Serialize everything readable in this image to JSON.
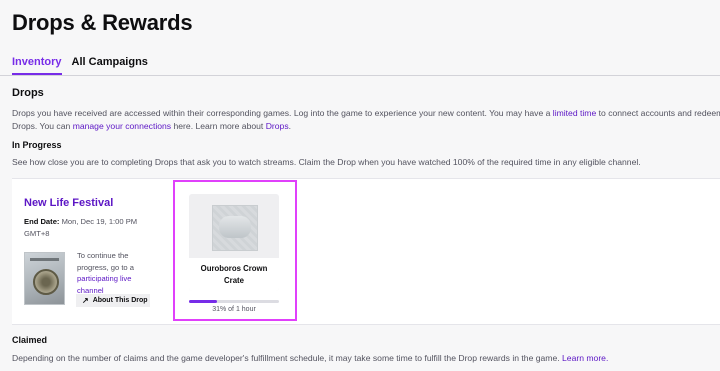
{
  "header": {
    "title": "Drops & Rewards"
  },
  "tabs": [
    {
      "label": "Inventory",
      "active": true
    },
    {
      "label": "All Campaigns",
      "active": false
    }
  ],
  "drops_section": {
    "heading": "Drops",
    "line1_before": "Drops you have received are accessed within their corresponding games. Log into the game to experience your new content. You may have a ",
    "line1_link": "limited time",
    "line1_after": " to connect accounts and redeem your",
    "line2_before": "Drops. You can ",
    "line2_link": "manage your connections",
    "line2_middle": " here. Learn more about ",
    "line2_link2": "Drops",
    "line2_end": "."
  },
  "in_progress": {
    "heading": "In Progress",
    "description": "See how close you are to completing Drops that ask you to watch streams. Claim the Drop when you have watched 100% of the required time in any eligible channel."
  },
  "campaign": {
    "title": "New Life Festival",
    "end_date_label": "End Date:",
    "end_date_value": " Mon, Dec 19, 1:00 PM GMT+8",
    "note_text": "To continue the progress, go to a ",
    "note_link": "participating live channel",
    "about_button": "About This Drop",
    "icons": {
      "about": "external-arrow-icon",
      "game": "game-box-art"
    }
  },
  "reward": {
    "name": "Ouroboros Crown Crate",
    "progress_percent": 31,
    "progress_text": "31% of 1 hour"
  },
  "claimed": {
    "heading": "Claimed",
    "text_before": "Depending on the number of claims and the game developer's fulfillment schedule, it may take some time to fulfill the Drop rewards in the game. ",
    "link": "Learn more."
  },
  "colors": {
    "accent": "#772ce8",
    "link": "#5c16c5",
    "highlight": "#e040fb"
  }
}
